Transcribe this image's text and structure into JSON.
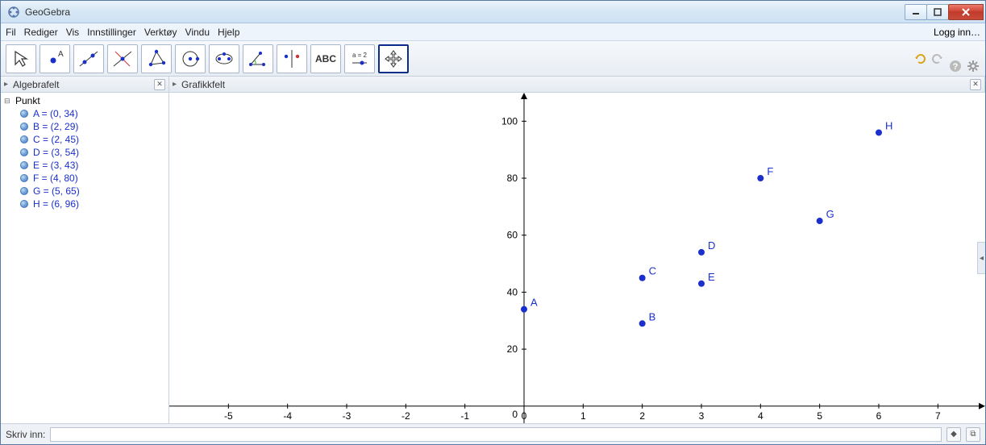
{
  "window": {
    "title": "GeoGebra"
  },
  "menu": {
    "items": [
      "Fil",
      "Rediger",
      "Vis",
      "Innstillinger",
      "Verktøy",
      "Vindu",
      "Hjelp"
    ],
    "login": "Logg inn…"
  },
  "toolbar": {
    "active_index": 11,
    "tools": [
      "move-tool",
      "point-tool",
      "line-tool",
      "perpendicular-tool",
      "polygon-tool",
      "circle-tool",
      "ellipse-tool",
      "angle-tool",
      "reflect-tool",
      "text-tool",
      "slider-tool",
      "move-view-tool"
    ],
    "text_tool_label": "ABC",
    "slider_tool_label": "a = 2"
  },
  "panels": {
    "algebra": {
      "title": "Algebrafelt"
    },
    "graphics": {
      "title": "Grafikkfelt"
    }
  },
  "algebra": {
    "group": "Punkt",
    "points": [
      {
        "name": "A",
        "text": "A = (0, 34)"
      },
      {
        "name": "B",
        "text": "B = (2, 29)"
      },
      {
        "name": "C",
        "text": "C = (2, 45)"
      },
      {
        "name": "D",
        "text": "D = (3, 54)"
      },
      {
        "name": "E",
        "text": "E = (3, 43)"
      },
      {
        "name": "F",
        "text": "F = (4, 80)"
      },
      {
        "name": "G",
        "text": "G = (5, 65)"
      },
      {
        "name": "H",
        "text": "H = (6, 96)"
      }
    ]
  },
  "chart_data": {
    "type": "scatter",
    "series": [
      {
        "name": "Punkt",
        "points": [
          {
            "label": "A",
            "x": 0,
            "y": 34
          },
          {
            "label": "B",
            "x": 2,
            "y": 29
          },
          {
            "label": "C",
            "x": 2,
            "y": 45
          },
          {
            "label": "D",
            "x": 3,
            "y": 54
          },
          {
            "label": "E",
            "x": 3,
            "y": 43
          },
          {
            "label": "F",
            "x": 4,
            "y": 80
          },
          {
            "label": "G",
            "x": 5,
            "y": 65
          },
          {
            "label": "H",
            "x": 6,
            "y": 96
          }
        ]
      }
    ],
    "x_ticks": [
      -5,
      -4,
      -3,
      -2,
      -1,
      0,
      1,
      2,
      3,
      4,
      5,
      6,
      7
    ],
    "y_ticks": [
      0,
      20,
      40,
      60,
      80,
      100
    ],
    "xlim": [
      -6,
      7.8
    ],
    "ylim": [
      -6,
      110
    ]
  },
  "inputbar": {
    "label": "Skriv inn:",
    "value": ""
  }
}
